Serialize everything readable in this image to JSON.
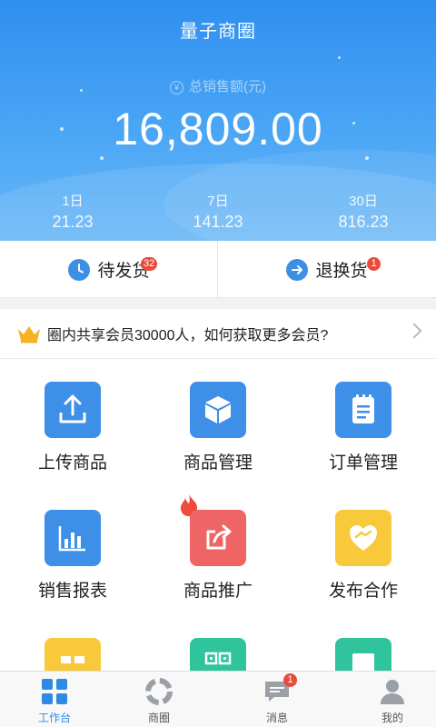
{
  "header": {
    "app_title": "量子商圈",
    "sales_label": "总销售额(元)",
    "sales_total": "16,809.00",
    "yen_symbol": "¥",
    "stats": [
      {
        "label": "1日",
        "value": "21.23"
      },
      {
        "label": "7日",
        "value": "141.23"
      },
      {
        "label": "30日",
        "value": "816.23"
      }
    ],
    "colors": {
      "gradient_top": "#2f8fef",
      "gradient_bottom": "#6ab8f7"
    }
  },
  "orders": {
    "pending": {
      "label": "待发货",
      "badge": "32",
      "icon": "clock-icon"
    },
    "returns": {
      "label": "退换货",
      "badge": "1",
      "icon": "return-icon"
    }
  },
  "promo": {
    "text": "圈内共享会员30000人，如何获取更多会员?",
    "icon": "crown-icon"
  },
  "grid": [
    {
      "label": "上传商品",
      "icon": "upload-icon",
      "color": "#3d8fe8"
    },
    {
      "label": "商品管理",
      "icon": "box-icon",
      "color": "#3d8fe8"
    },
    {
      "label": "订单管理",
      "icon": "clipboard-icon",
      "color": "#3d8fe8"
    },
    {
      "label": "销售报表",
      "icon": "bar-chart-icon",
      "color": "#3d8fe8"
    },
    {
      "label": "商品推广",
      "icon": "share-icon",
      "color": "#ef6464",
      "hot": true
    },
    {
      "label": "发布合作",
      "icon": "handshake-heart-icon",
      "color": "#f8c93b"
    },
    {
      "label": "",
      "icon": "gift-icon",
      "color": "#f8c93b"
    },
    {
      "label": "",
      "icon": "qr-code-icon",
      "color": "#2fc49b"
    },
    {
      "label": "",
      "icon": "square-icon",
      "color": "#2fc49b"
    }
  ],
  "tabbar": [
    {
      "label": "工作台",
      "icon": "workbench-icon",
      "active": true
    },
    {
      "label": "商圈",
      "icon": "circle-icon",
      "active": false
    },
    {
      "label": "消息",
      "icon": "message-icon",
      "active": false,
      "badge": "1"
    },
    {
      "label": "我的",
      "icon": "user-icon",
      "active": false
    }
  ]
}
